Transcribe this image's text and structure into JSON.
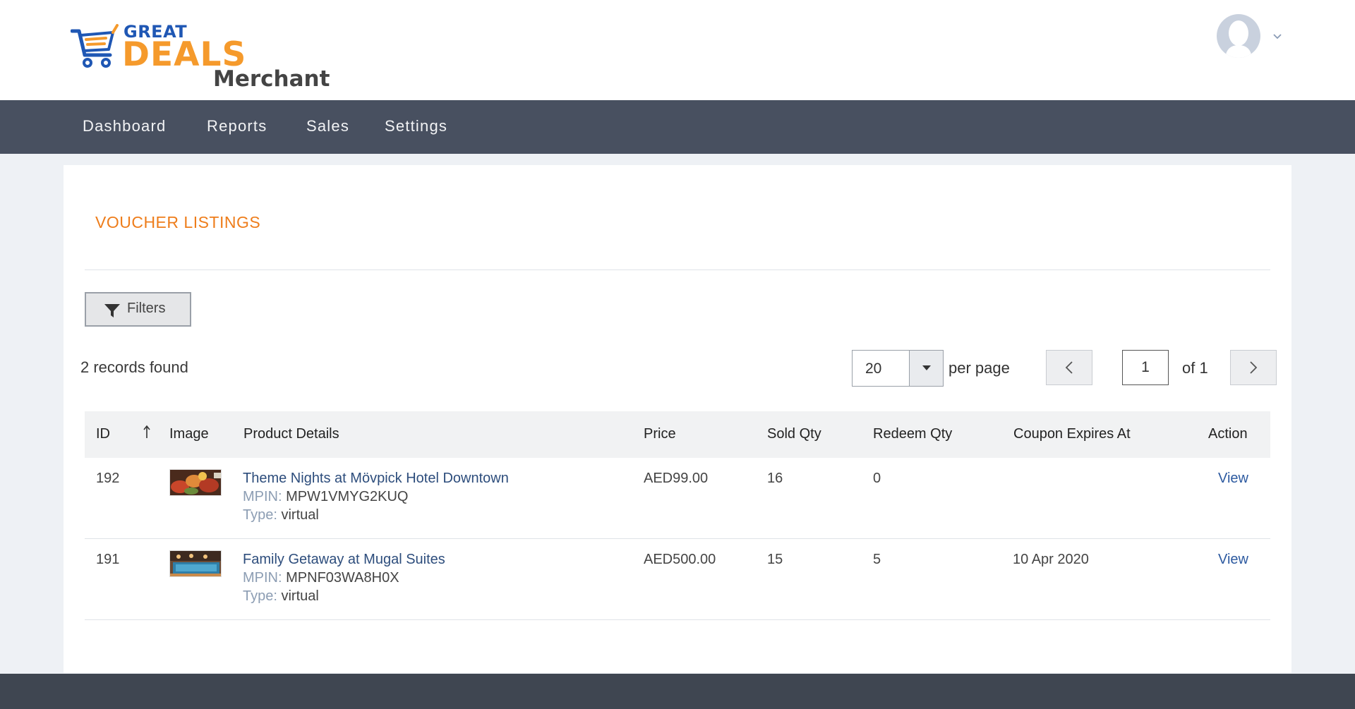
{
  "brand": {
    "line1": "GREAT",
    "line2": "DEALS",
    "line3": "Merchant"
  },
  "nav": {
    "items": [
      {
        "label": "Dashboard"
      },
      {
        "label": "Reports"
      },
      {
        "label": "Sales"
      },
      {
        "label": "Settings"
      }
    ]
  },
  "page": {
    "title": "VOUCHER LISTINGS",
    "filters_label": "Filters",
    "records_text": "2 records found"
  },
  "pagination": {
    "per_page_value": "20",
    "per_page_label": "per page",
    "current_page": "1",
    "of_text": "of 1"
  },
  "table": {
    "columns": [
      "ID",
      "Image",
      "Product Details",
      "Price",
      "Sold Qty",
      "Redeem Qty",
      "Coupon Expires At",
      "Action"
    ],
    "mpin_key": "MPIN:",
    "type_key": "Type:",
    "rows": [
      {
        "id": "192",
        "name": "Theme Nights at Mövpick Hotel Downtown",
        "mpin": "MPW1VMYG2KUQ",
        "type": "virtual",
        "price": "AED99.00",
        "sold": "16",
        "redeem": "0",
        "expires": "",
        "action": "View"
      },
      {
        "id": "191",
        "name": "Family Getaway at Mugal Suites",
        "mpin": "MPNF03WA8H0X",
        "type": "virtual",
        "price": "AED500.00",
        "sold": "15",
        "redeem": "5",
        "expires": "10 Apr 2020",
        "action": "View"
      }
    ]
  },
  "colors": {
    "nav_bg": "#485060",
    "accent_orange": "#ee7d1b",
    "link_blue": "#2d4d7c",
    "brand_blue": "#1f57b4",
    "brand_orange": "#f59a2c"
  },
  "icons": [
    "cart-logo-icon",
    "user-avatar-icon",
    "chevron-down-icon",
    "funnel-icon",
    "sort-arrow-up-icon",
    "chevron-left-icon",
    "chevron-right-icon",
    "caret-down-icon"
  ]
}
